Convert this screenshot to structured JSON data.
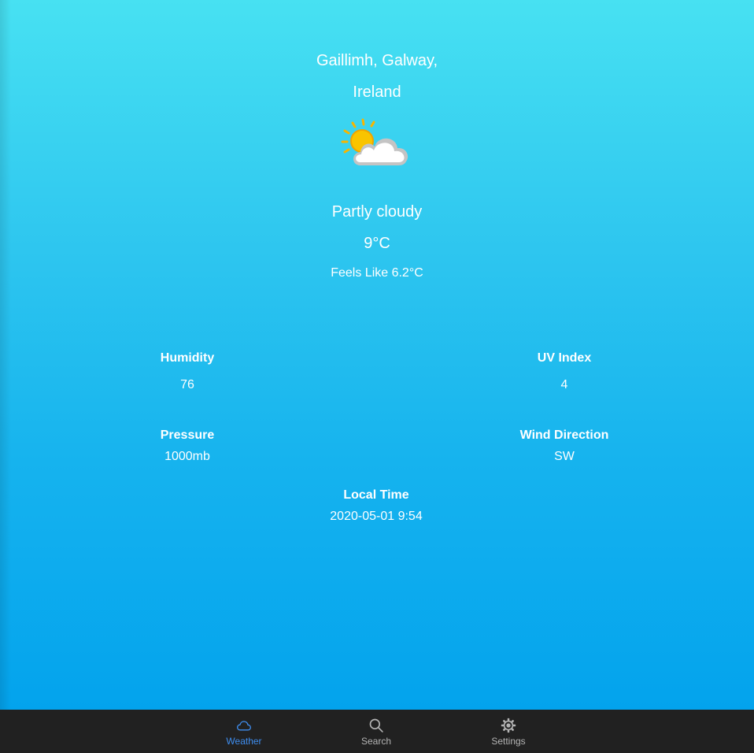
{
  "location": {
    "line1": "Gaillimh, Galway,",
    "line2": "Ireland"
  },
  "current": {
    "icon": "partly-cloudy-icon",
    "condition": "Partly cloudy",
    "temperature": "9°C",
    "feels_like": "Feels Like 6.2°C"
  },
  "stats": {
    "humidity": {
      "label": "Humidity",
      "value": "76"
    },
    "uv_index": {
      "label": "UV Index",
      "value": "4"
    },
    "pressure": {
      "label": "Pressure",
      "value": "1000mb"
    },
    "wind_direction": {
      "label": "Wind Direction",
      "value": "SW"
    },
    "local_time": {
      "label": "Local Time",
      "value": "2020-05-01 9:54"
    }
  },
  "nav": {
    "items": [
      {
        "label": "Weather",
        "icon": "cloud-icon",
        "active": true
      },
      {
        "label": "Search",
        "icon": "search-icon",
        "active": false
      },
      {
        "label": "Settings",
        "icon": "gear-icon",
        "active": false
      }
    ]
  },
  "colors": {
    "background_top": "#47e1f2",
    "background_bottom": "#03a3ed",
    "navbar": "#212121",
    "active_nav": "#3f8ef0",
    "inactive_nav": "#b4b4b4"
  }
}
